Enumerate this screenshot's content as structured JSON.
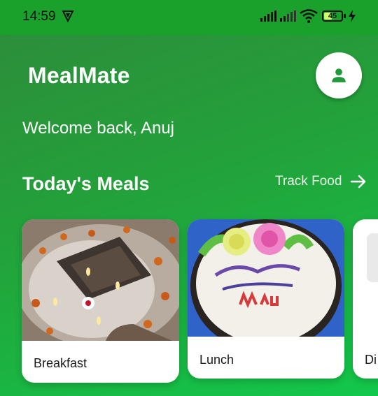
{
  "status_bar": {
    "time": "14:59",
    "battery_level": "45",
    "battery_fraction": 0.45,
    "icons": [
      "vpn-icon",
      "signal-icon",
      "signal-icon",
      "wifi-icon",
      "battery-icon",
      "charging-icon"
    ]
  },
  "header": {
    "app_title": "MealMate",
    "profile_icon": "person-icon"
  },
  "welcome_text": "Welcome back, Anuj",
  "section": {
    "title": "Today's Meals",
    "track_food_label": "Track Food",
    "track_food_icon": "arrow-right-icon"
  },
  "meals": [
    {
      "label": "Breakfast"
    },
    {
      "label": "Lunch"
    },
    {
      "label": "Di"
    }
  ],
  "colors": {
    "primary_green": "#1aa12c",
    "accent_green": "#12c84a",
    "card": "#ffffff",
    "icon_green": "#1e9b38"
  }
}
